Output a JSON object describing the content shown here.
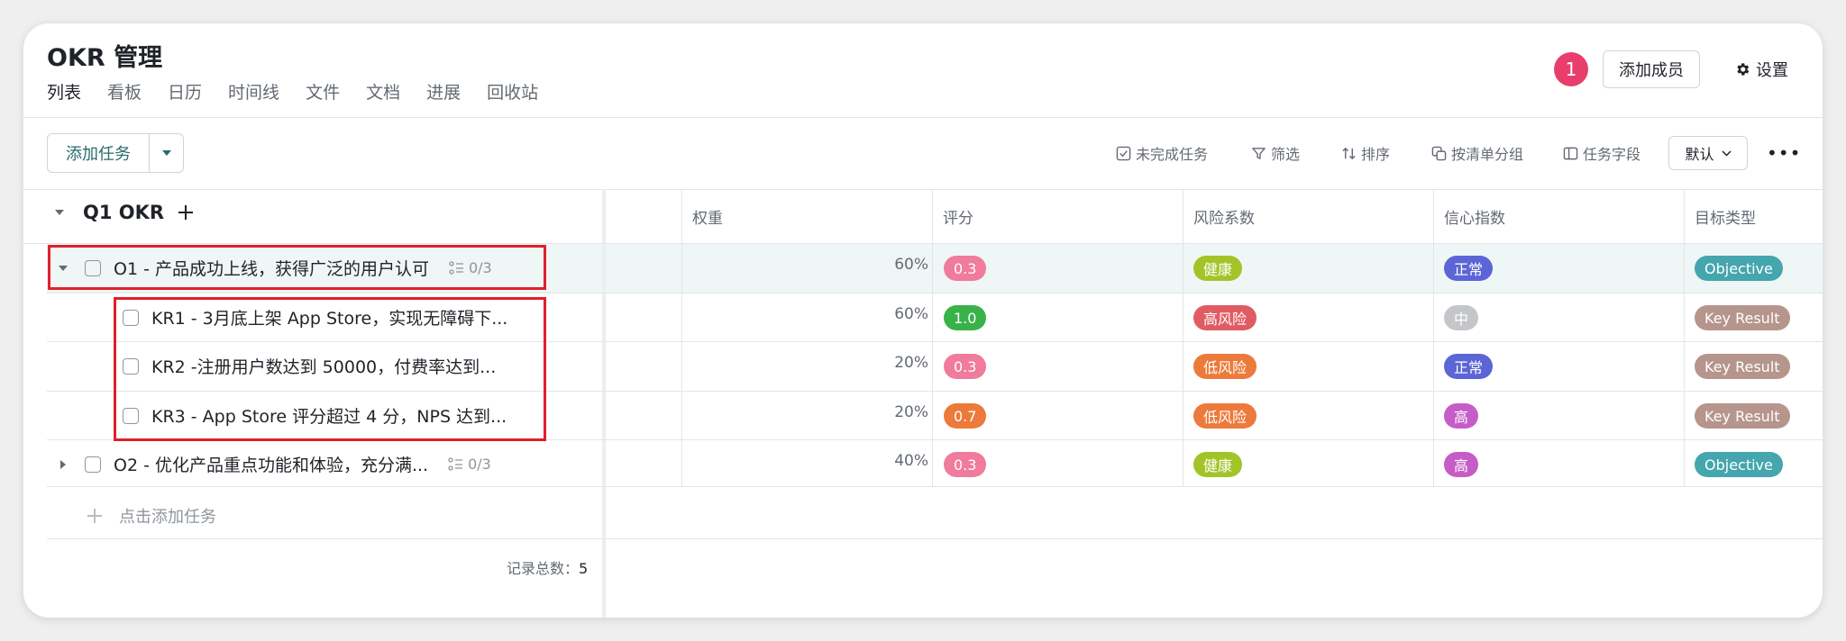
{
  "header": {
    "title": "OKR 管理",
    "badge_count": "1",
    "add_member": "添加成员",
    "settings": "设置"
  },
  "tabs": [
    "列表",
    "看板",
    "日历",
    "时间线",
    "文件",
    "文档",
    "进展",
    "回收站"
  ],
  "toolbar": {
    "add_task": "添加任务",
    "incomplete": "未完成任务",
    "filter": "筛选",
    "sort": "排序",
    "group_by": "按清单分组",
    "fields": "任务字段",
    "default": "默认"
  },
  "table": {
    "group": "Q1 OKR",
    "columns": [
      "权重",
      "评分",
      "风险系数",
      "信心指数",
      "目标类型"
    ],
    "rows": [
      {
        "title": "O1 - 产品成功上线，获得广泛的用户认可",
        "subtasks": "0/3",
        "weight": "60%",
        "score": "0.3",
        "risk": "健康",
        "confidence": "正常",
        "type": "Objective"
      },
      {
        "title": "KR1 - 3月底上架 App Store，实现无障碍下...",
        "weight": "60%",
        "score": "1.0",
        "risk": "高风险",
        "confidence": "中",
        "type": "Key Result"
      },
      {
        "title": "KR2 -注册用户数达到 50000，付费率达到...",
        "weight": "20%",
        "score": "0.3",
        "risk": "低风险",
        "confidence": "正常",
        "type": "Key Result"
      },
      {
        "title": "KR3 - App Store 评分超过 4 分，NPS 达到...",
        "weight": "20%",
        "score": "0.7",
        "risk": "低风险",
        "confidence": "高",
        "type": "Key Result"
      },
      {
        "title": "O2 - 优化产品重点功能和体验，充分满...",
        "subtasks": "0/3",
        "weight": "40%",
        "score": "0.3",
        "risk": "健康",
        "confidence": "高",
        "type": "Objective"
      }
    ],
    "add_task_row": "点击添加任务",
    "total_label": "记录总数：",
    "total_value": "5"
  },
  "colors": {
    "score_pink": "#f07b9c",
    "score_green": "#3ab24a",
    "score_orange": "#ec7a3b",
    "risk_healthy": "#a3c429",
    "risk_high": "#e05c63",
    "risk_low": "#ec7a3b",
    "conf_normal": "#5b65d6",
    "conf_mid": "#c4c6ca",
    "conf_high": "#c65cc8",
    "type_objective": "#45a6ad",
    "type_kr": "#b5958c",
    "highlight_border": "#e0202a",
    "badge": "#e83e6c"
  }
}
